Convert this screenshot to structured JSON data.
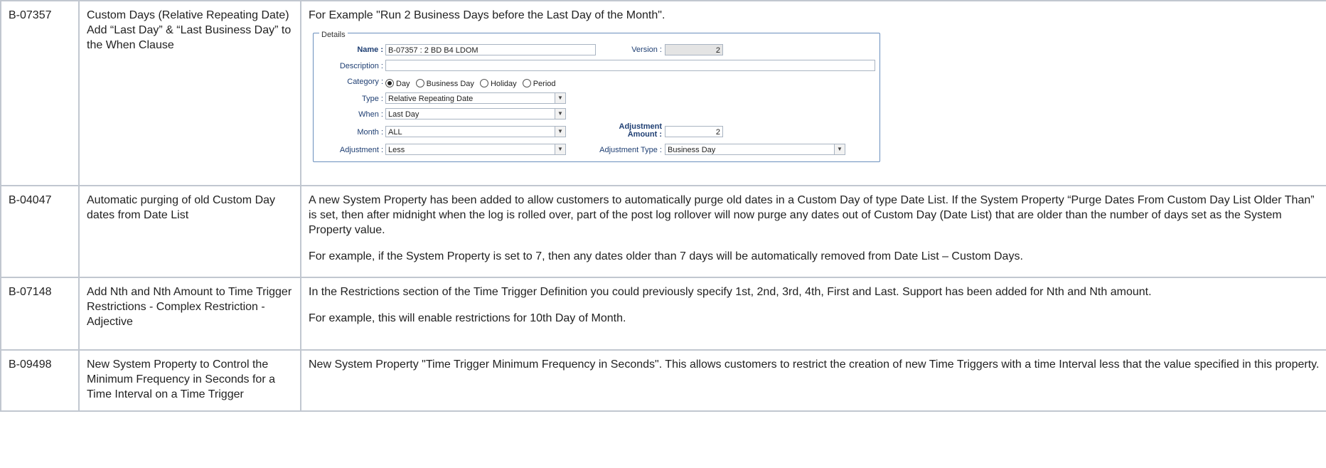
{
  "rows": [
    {
      "id": "B-07357",
      "title": "Custom Days (Relative Repeating Date) Add “Last Day” & “Last Business Day” to the When Clause",
      "paragraphs": [
        "For Example \"Run 2 Business Days before the Last Day of the Month\"."
      ]
    },
    {
      "id": "B-04047",
      "title": "Automatic purging of old Custom Day dates from Date List",
      "paragraphs": [
        "A new System Property has been added to allow customers to automatically purge old dates in a Custom Day of type Date List. If the System Property “Purge Dates From Custom Day List Older Than” is set, then after midnight when the log is rolled over, part of the post log rollover will now purge any dates out of Custom Day (Date List) that are older than the number of days set as the System Property value.",
        "For example, if the System Property is set to 7, then any dates older than 7 days will be automatically removed from Date List – Custom Days."
      ]
    },
    {
      "id": "B-07148",
      "title": "Add Nth and Nth Amount to Time Trigger Restrictions - Complex Restriction - Adjective",
      "paragraphs": [
        "In the Restrictions section of the Time Trigger Definition you could previously specify 1st, 2nd, 3rd, 4th, First and Last. Support has been added for Nth and Nth amount.",
        "For example, this will enable restrictions for 10th Day of Month."
      ]
    },
    {
      "id": "B-09498",
      "title": "New System Property to Control the Minimum Frequency in Seconds for a Time Interval on a Time Trigger",
      "paragraphs": [
        "New System Property \"Time Trigger Minimum Frequency in Seconds\". This allows customers to restrict the creation of new Time Triggers with a time Interval less that the value specified in this property."
      ]
    }
  ],
  "details": {
    "legend": "Details",
    "name_label": "Name :",
    "name_value": "B-07357 : 2 BD B4 LDOM",
    "version_label": "Version :",
    "version_value": "2",
    "description_label": "Description :",
    "description_value": "",
    "category_label": "Category :",
    "category_options": [
      "Day",
      "Business Day",
      "Holiday",
      "Period"
    ],
    "category_selected": "Day",
    "type_label": "Type :",
    "type_value": "Relative Repeating Date",
    "when_label": "When :",
    "when_value": "Last Day",
    "month_label": "Month :",
    "month_value": "ALL",
    "adj_amount_label_1": "Adjustment",
    "adj_amount_label_2": "Amount :",
    "adj_amount_value": "2",
    "adjustment_label": "Adjustment :",
    "adjustment_value": "Less",
    "adj_type_label": "Adjustment Type :",
    "adj_type_value": "Business Day",
    "dropdown_icon": "chevron-down-icon"
  }
}
